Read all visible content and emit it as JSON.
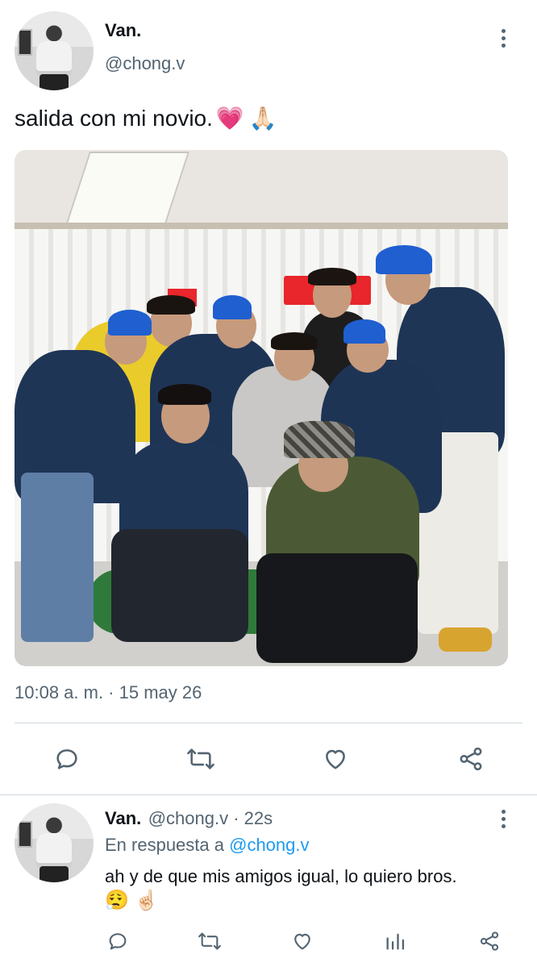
{
  "tweet": {
    "author_name": "Van.",
    "author_handle": "@chong.v",
    "text": "salida con mi novio.",
    "emojis": [
      "💗",
      "🙏🏻"
    ],
    "timestamp": "10:08 a. m. · 15 may 26"
  },
  "reply": {
    "author_name": "Van.",
    "meta": "@chong.v · 22s",
    "replying_prefix": "En respuesta a",
    "replying_to": "@chong.v",
    "text": "ah y de que mis amigos igual, lo quiero bros.",
    "emojis": [
      "😮‍💨",
      "☝🏻"
    ]
  },
  "icons": {
    "reply": "reply-icon",
    "retweet": "retweet-icon",
    "like": "heart-icon",
    "share": "share-icon",
    "views": "views-icon",
    "more": "more-icon"
  },
  "colors": {
    "text_primary": "#0f1419",
    "text_secondary": "#536471",
    "link": "#1d9bf0",
    "divider": "#cfd9de",
    "cap_blue": "#1f5fd0",
    "jacket_navy": "#1e3455"
  }
}
